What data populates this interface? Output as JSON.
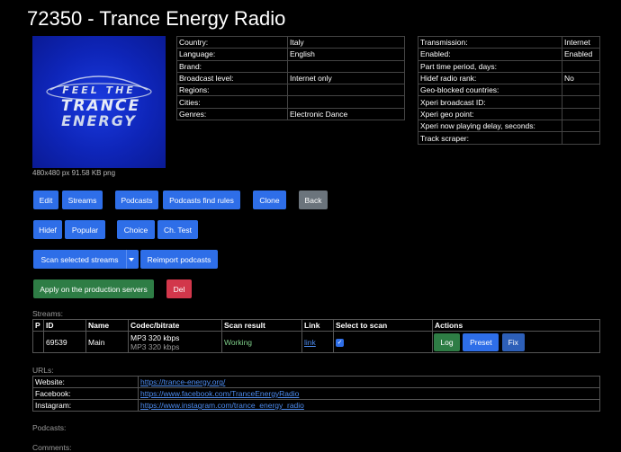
{
  "page": {
    "title": "72350 - Trance Energy Radio"
  },
  "logo": {
    "line1": "FEEL THE",
    "line2": "TRANCE",
    "line3": "ENERGY",
    "caption": "480x480 px 91.58 KB png"
  },
  "info_left": [
    {
      "label": "Country:",
      "value": "Italy"
    },
    {
      "label": "Language:",
      "value": "English"
    },
    {
      "label": "Brand:",
      "value": ""
    },
    {
      "label": "Broadcast level:",
      "value": "Internet only"
    },
    {
      "label": "Regions:",
      "value": ""
    },
    {
      "label": "Cities:",
      "value": ""
    },
    {
      "label": "Genres:",
      "value": "Electronic Dance"
    }
  ],
  "info_right": [
    {
      "label": "Transmission:",
      "value": "Internet"
    },
    {
      "label": "Enabled:",
      "value": "Enabled"
    },
    {
      "label": "Part time period, days:",
      "value": ""
    },
    {
      "label": "Hidef radio rank:",
      "value": "No"
    },
    {
      "label": "Geo-blocked countries:",
      "value": ""
    },
    {
      "label": "Xperi broadcast ID:",
      "value": ""
    },
    {
      "label": "Xperi geo point:",
      "value": ""
    },
    {
      "label": "Xperi now playing delay, seconds:",
      "value": ""
    },
    {
      "label": "Track scraper:",
      "value": ""
    }
  ],
  "buttons": {
    "edit": "Edit",
    "streams": "Streams",
    "podcasts": "Podcasts",
    "podcasts_find_rules": "Podcasts find rules",
    "clone": "Clone",
    "back": "Back",
    "hidef": "Hidef",
    "popular": "Popular",
    "choice": "Choice",
    "ch_test": "Ch. Test",
    "scan_selected": "Scan selected streams",
    "reimport_podcasts": "Reimport podcasts",
    "apply_production": "Apply on the production servers",
    "del": "Del"
  },
  "streams": {
    "label": "Streams:",
    "headers": [
      "P",
      "ID",
      "Name",
      "Codec/bitrate",
      "Scan result",
      "Link",
      "Select to scan",
      "Actions"
    ],
    "rows": [
      {
        "p": "",
        "id": "69539",
        "name": "Main",
        "codec": "MP3 320 kbps",
        "codec_sub": "MP3 320 kbps",
        "scan_result": "Working",
        "link": "link",
        "selected": true,
        "actions": {
          "log": "Log",
          "preset": "Preset",
          "fix": "Fix"
        }
      }
    ]
  },
  "urls": {
    "label": "URLs:",
    "rows": [
      {
        "label": "Website:",
        "url": "https://trance-energy.org/"
      },
      {
        "label": "Facebook:",
        "url": "https://www.facebook.com/TranceEnergyRadio"
      },
      {
        "label": "Instagram:",
        "url": "https://www.instagram.com/trance_energy_radio"
      }
    ]
  },
  "podcasts_label": "Podcasts:",
  "comments_label": "Comments:",
  "colors": {
    "primary": "#2e6ee8",
    "secondary": "#6b747c",
    "success": "#2e7d45",
    "danger": "#d2374b",
    "logo_bg": "#1230c9"
  }
}
